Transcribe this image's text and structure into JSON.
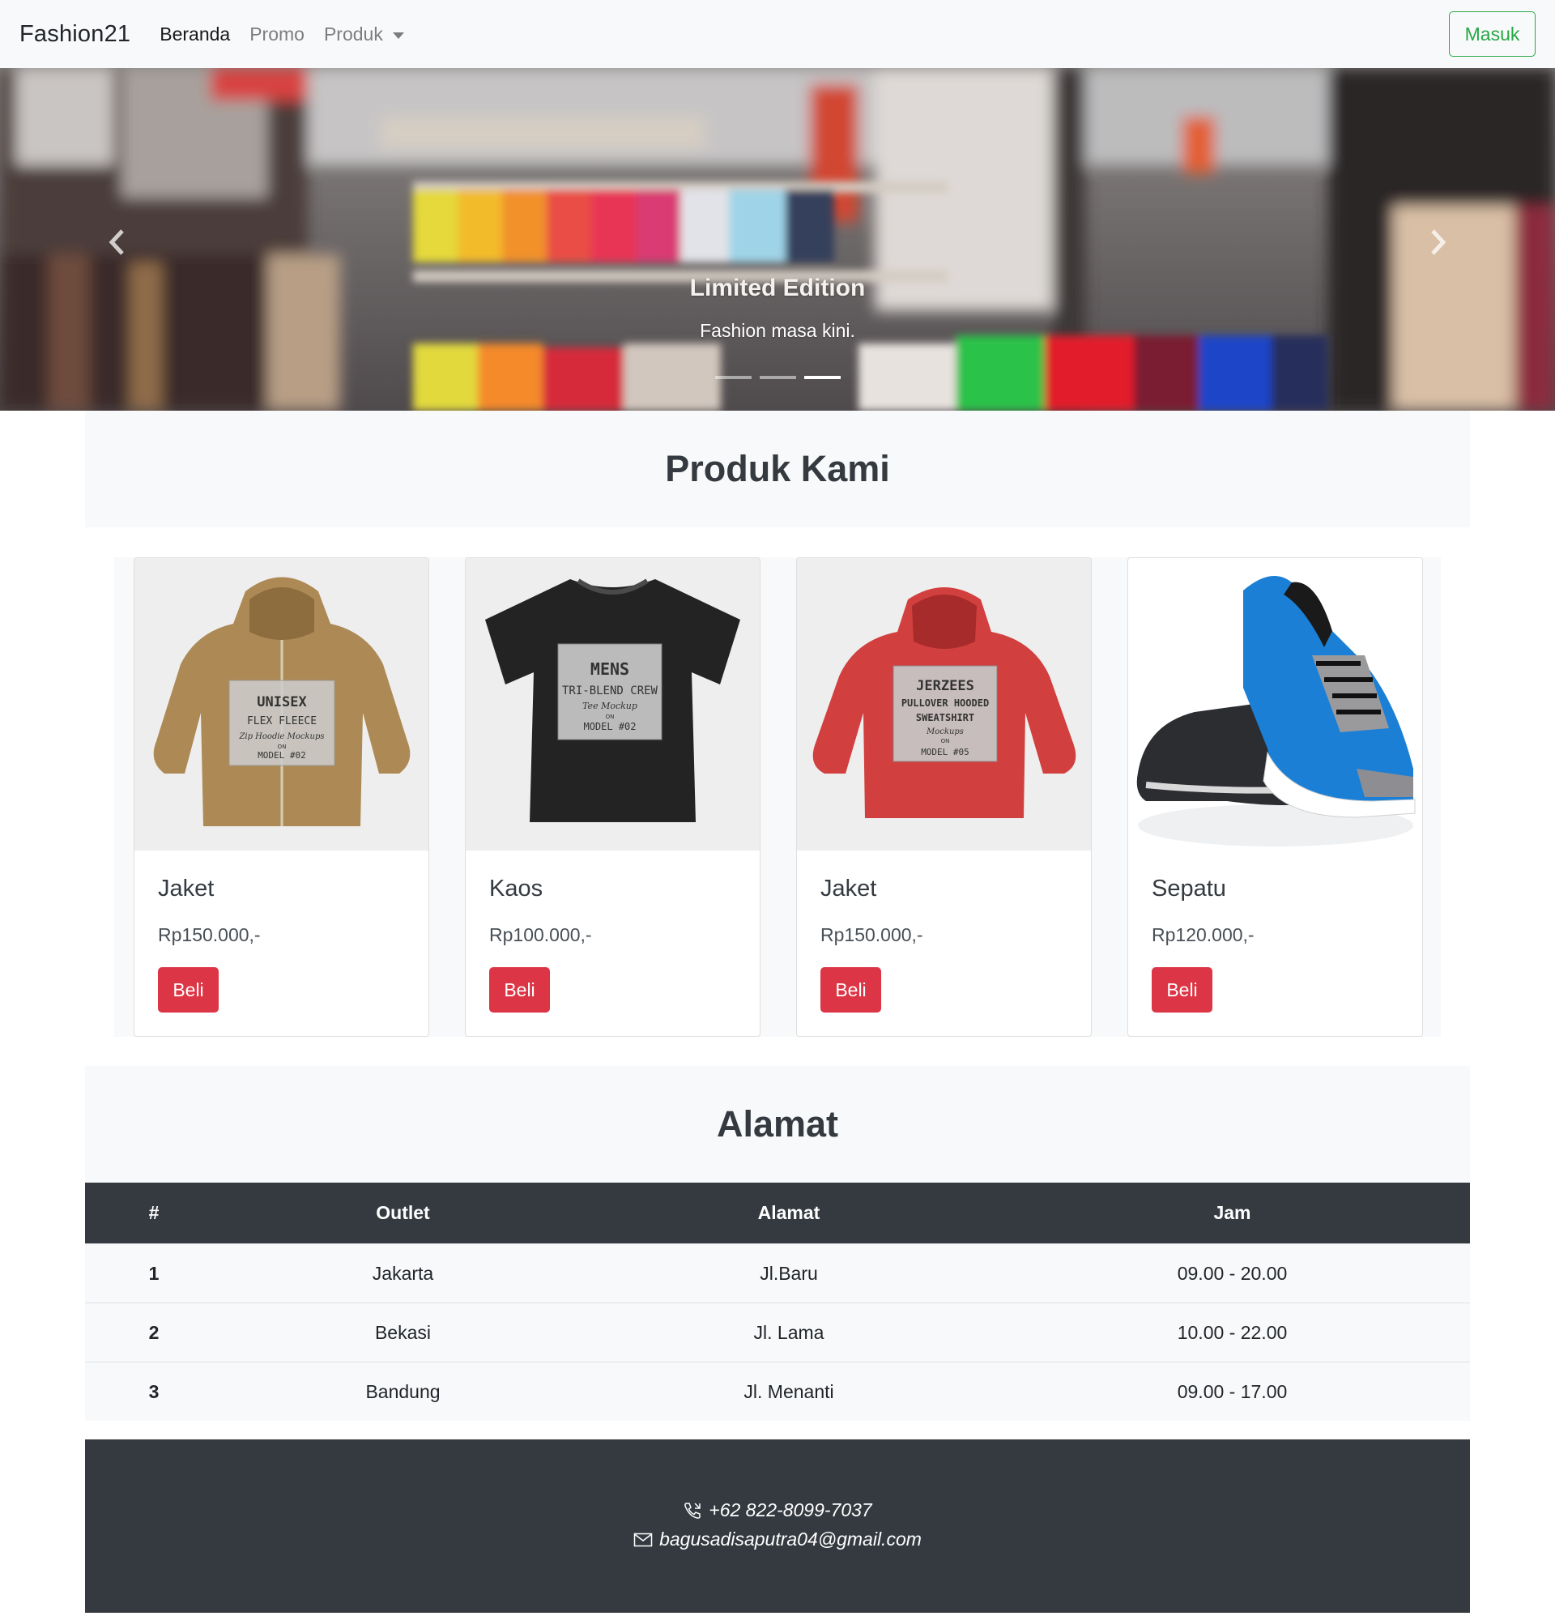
{
  "navbar": {
    "brand": "Fashion21",
    "links": [
      {
        "label": "Beranda"
      },
      {
        "label": "Promo"
      },
      {
        "label": "Produk"
      }
    ],
    "login_label": "Masuk",
    "login_color": "#28a745"
  },
  "carousel": {
    "caption_title": "Limited Edition",
    "caption_text": "Fashion masa kini.",
    "slide_count": 3,
    "active_slide": 3
  },
  "products": {
    "heading": "Produk Kami",
    "items": [
      {
        "name": "Jaket",
        "price": "Rp150.000,-",
        "button": "Beli",
        "image": "brown-hoodie",
        "mock": [
          "UNISEX",
          "FLEX FLEECE",
          "Zip Hoodie Mockups",
          "ON",
          "MODEL #02"
        ]
      },
      {
        "name": "Kaos",
        "price": "Rp100.000,-",
        "button": "Beli",
        "image": "black-tshirt",
        "mock": [
          "MENS",
          "TRI-BLEND CREW",
          "Tee Mockup",
          "ON",
          "MODEL #02"
        ]
      },
      {
        "name": "Jaket",
        "price": "Rp150.000,-",
        "button": "Beli",
        "image": "red-hoodie",
        "mock": [
          "JERZEES",
          "PULLOVER HOODED",
          "SWEATSHIRT",
          "Mockups",
          "ON",
          "MODEL #05"
        ]
      },
      {
        "name": "Sepatu",
        "price": "Rp120.000,-",
        "button": "Beli",
        "image": "blue-sneakers"
      }
    ],
    "button_color": "#dc3545"
  },
  "address": {
    "heading": "Alamat",
    "columns": [
      "#",
      "Outlet",
      "Alamat",
      "Jam"
    ],
    "rows": [
      [
        "1",
        "Jakarta",
        "Jl.Baru",
        "09.00 - 20.00"
      ],
      [
        "2",
        "Bekasi",
        "Jl. Lama",
        "10.00 - 22.00"
      ],
      [
        "3",
        "Bandung",
        "Jl. Menanti",
        "09.00 - 17.00"
      ]
    ]
  },
  "footer": {
    "phone": "+62 822-8099-7037",
    "email": "bagusadisaputra04@gmail.com",
    "phone_icon": "phone-icon",
    "email_icon": "envelope-icon"
  }
}
